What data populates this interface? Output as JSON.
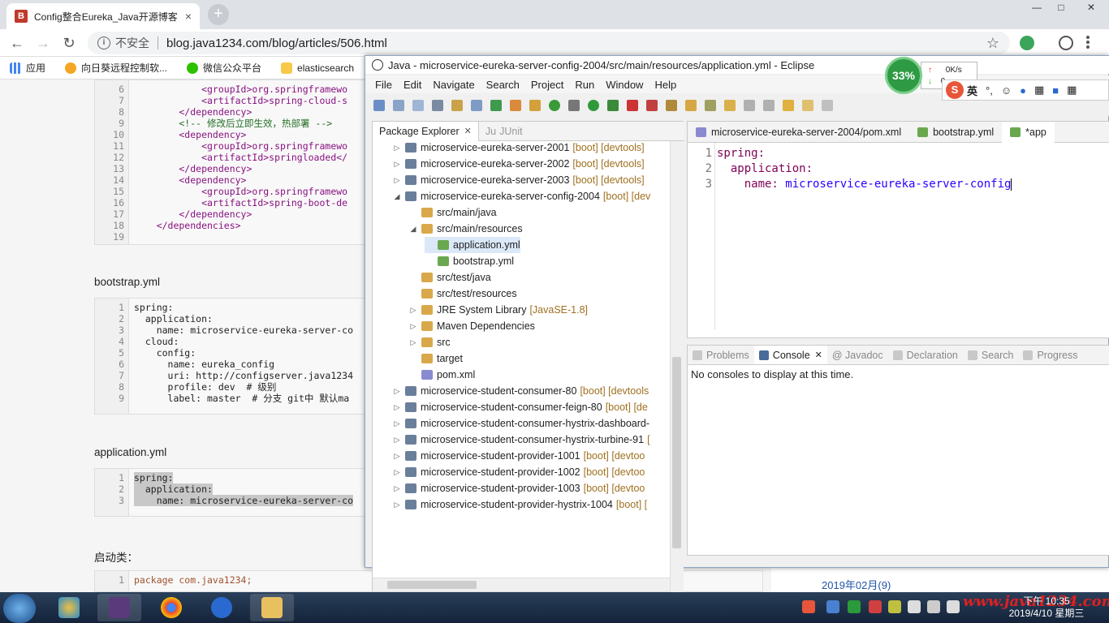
{
  "browser": {
    "tab_title": "Config整合Eureka_Java开源博客",
    "tab_close": "×",
    "new_tab": "+",
    "security_label": "不安全",
    "url": "blog.java1234.com/blog/articles/506.html",
    "back": "←",
    "forward": "→",
    "reload": "↻",
    "star": "☆",
    "win_min": "—",
    "win_max": "□",
    "win_close": "✕",
    "bookmarks": [
      "应用",
      "向日葵远程控制软...",
      "微信公众平台",
      "elasticsearch"
    ]
  },
  "blog": {
    "code1": [
      {
        "n": "6",
        "t": "            <groupId>org.springframewo"
      },
      {
        "n": "7",
        "t": "            <artifactId>spring-cloud-s"
      },
      {
        "n": "8",
        "t": "        </dependency>"
      },
      {
        "n": "9",
        "t": "        <!-- 修改后立即生效，热部署 -->"
      },
      {
        "n": "10",
        "t": "        <dependency>"
      },
      {
        "n": "11",
        "t": "            <groupId>org.springframewo"
      },
      {
        "n": "12",
        "t": "            <artifactId>springloaded</"
      },
      {
        "n": "13",
        "t": "        </dependency>"
      },
      {
        "n": "14",
        "t": "        <dependency>"
      },
      {
        "n": "15",
        "t": "            <groupId>org.springframewo"
      },
      {
        "n": "16",
        "t": "            <artifactId>spring-boot-de"
      },
      {
        "n": "17",
        "t": "        </dependency>"
      },
      {
        "n": "18",
        "t": "    </dependencies>"
      },
      {
        "n": "19",
        "t": ""
      }
    ],
    "h_bootstrap": "bootstrap.yml",
    "code2": [
      {
        "n": "1",
        "t": "spring:"
      },
      {
        "n": "2",
        "t": "  application:"
      },
      {
        "n": "3",
        "t": "    name: microservice-eureka-server-co"
      },
      {
        "n": "4",
        "t": "  cloud:"
      },
      {
        "n": "5",
        "t": "    config:"
      },
      {
        "n": "6",
        "t": "      name: eureka_config"
      },
      {
        "n": "7",
        "t": "      uri: http://configserver.java1234"
      },
      {
        "n": "8",
        "t": "      profile: dev  # 级别"
      },
      {
        "n": "9",
        "t": "      label: master  # 分支 git中 默认ma"
      }
    ],
    "h_application": "application.yml",
    "code3": [
      {
        "n": "1",
        "t": "spring:"
      },
      {
        "n": "2",
        "t": "  application:"
      },
      {
        "n": "3",
        "t": "    name: microservice-eureka-server-co"
      }
    ],
    "h_start": "启动类：",
    "code4": [
      {
        "n": "1",
        "t": "package com.java1234;"
      }
    ],
    "date_link": "2019年02月(9)"
  },
  "eclipse": {
    "title": "Java - microservice-eureka-server-config-2004/src/main/resources/application.yml - Eclipse",
    "menu": [
      "File",
      "Edit",
      "Navigate",
      "Search",
      "Project",
      "Run",
      "Window",
      "Help"
    ],
    "pe_tab": "Package Explorer",
    "junit_tab": "JUnit",
    "tree": [
      {
        "d": 0,
        "arr": "▷",
        "t": "microservice-eureka-server-2001",
        "dec": "[boot] [devtools]"
      },
      {
        "d": 0,
        "arr": "▷",
        "t": "microservice-eureka-server-2002",
        "dec": "[boot] [devtools]"
      },
      {
        "d": 0,
        "arr": "▷",
        "t": "microservice-eureka-server-2003",
        "dec": "[boot] [devtools]"
      },
      {
        "d": 0,
        "arr": "◢",
        "t": "microservice-eureka-server-config-2004",
        "dec": "[boot] [dev"
      },
      {
        "d": 1,
        "arr": "",
        "t": "src/main/java",
        "dec": ""
      },
      {
        "d": 1,
        "arr": "◢",
        "t": "src/main/resources",
        "dec": ""
      },
      {
        "d": 2,
        "arr": "",
        "t": "application.yml",
        "dec": "",
        "sel": true
      },
      {
        "d": 2,
        "arr": "",
        "t": "bootstrap.yml",
        "dec": ""
      },
      {
        "d": 1,
        "arr": "",
        "t": "src/test/java",
        "dec": ""
      },
      {
        "d": 1,
        "arr": "",
        "t": "src/test/resources",
        "dec": ""
      },
      {
        "d": 1,
        "arr": "▷",
        "t": "JRE System Library",
        "dec": "[JavaSE-1.8]"
      },
      {
        "d": 1,
        "arr": "▷",
        "t": "Maven Dependencies",
        "dec": ""
      },
      {
        "d": 1,
        "arr": "▷",
        "t": "src",
        "dec": ""
      },
      {
        "d": 1,
        "arr": "",
        "t": "target",
        "dec": ""
      },
      {
        "d": 1,
        "arr": "",
        "t": "pom.xml",
        "dec": ""
      },
      {
        "d": 0,
        "arr": "▷",
        "t": "microservice-student-consumer-80",
        "dec": "[boot] [devtools"
      },
      {
        "d": 0,
        "arr": "▷",
        "t": "microservice-student-consumer-feign-80",
        "dec": "[boot] [de"
      },
      {
        "d": 0,
        "arr": "▷",
        "t": "microservice-student-consumer-hystrix-dashboard-",
        "dec": ""
      },
      {
        "d": 0,
        "arr": "▷",
        "t": "microservice-student-consumer-hystrix-turbine-91",
        "dec": "["
      },
      {
        "d": 0,
        "arr": "▷",
        "t": "microservice-student-provider-1001",
        "dec": "[boot] [devtoo"
      },
      {
        "d": 0,
        "arr": "▷",
        "t": "microservice-student-provider-1002",
        "dec": "[boot] [devtoo"
      },
      {
        "d": 0,
        "arr": "▷",
        "t": "microservice-student-provider-1003",
        "dec": "[boot] [devtoo"
      },
      {
        "d": 0,
        "arr": "▷",
        "t": "microservice-student-provider-hystrix-1004",
        "dec": "[boot] ["
      }
    ],
    "editor_tabs": [
      "microservice-eureka-server-2004/pom.xml",
      "bootstrap.yml",
      "*app"
    ],
    "editor_lines": [
      {
        "n": "1",
        "k": "spring:",
        "v": ""
      },
      {
        "n": "2",
        "k": "  application:",
        "v": ""
      },
      {
        "n": "3",
        "k": "    name:",
        "v": " microservice-eureka-server-config"
      }
    ],
    "console_tabs": [
      "Problems",
      "Console",
      "@ Javadoc",
      "Declaration",
      "Search",
      "Progress"
    ],
    "console_msg": "No consoles to display at this time."
  },
  "overlay": {
    "cpu": "33%",
    "net_up": "0K/s",
    "net_down": "0",
    "ime_logo": "S",
    "ime_lang": "英"
  },
  "taskbar": {
    "time": "下午 10:35",
    "date": "2019/4/10 星期三",
    "watermark": "www.java1234.com"
  },
  "colors": {
    "yaml_key": "#7f0055",
    "yaml_value": "#2a00ff",
    "xml_tag": "#881280",
    "selection": "#dbe8f8"
  }
}
